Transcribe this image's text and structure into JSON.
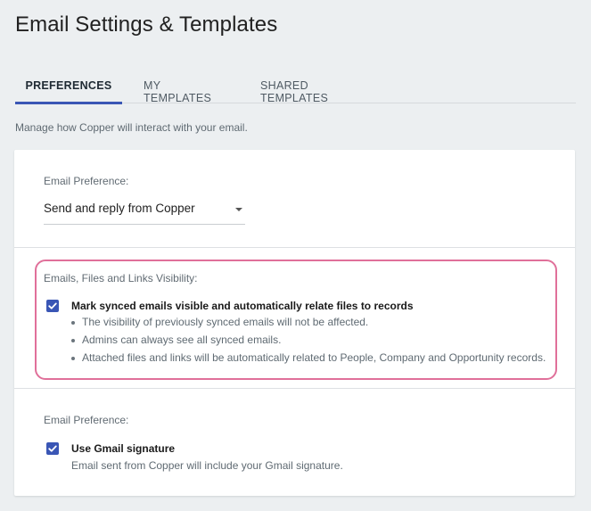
{
  "page": {
    "title": "Email Settings & Templates",
    "intro": "Manage how Copper will interact with your email."
  },
  "tabs": [
    {
      "label": "PREFERENCES",
      "active": true
    },
    {
      "label": "MY TEMPLATES",
      "active": false
    },
    {
      "label": "SHARED TEMPLATES",
      "active": false
    }
  ],
  "colors": {
    "accent": "#3a56b5",
    "highlight": "#e0709a",
    "background": "#eceff1"
  },
  "sections": {
    "email_preference": {
      "label": "Email Preference:",
      "selected": "Send and reply from Copper"
    },
    "visibility": {
      "label": "Emails, Files and Links Visibility:",
      "checkbox_label": "Mark synced emails visible and automatically relate files to records",
      "checked": true,
      "bullets": [
        "The visibility of previously synced emails will not be affected.",
        "Admins can always see all synced emails.",
        "Attached files and links will be automatically related to People, Company and Opportunity records."
      ]
    },
    "signature": {
      "label": "Email Preference:",
      "checkbox_label": "Use Gmail signature",
      "checked": true,
      "description": "Email sent from Copper will include your Gmail signature."
    }
  }
}
